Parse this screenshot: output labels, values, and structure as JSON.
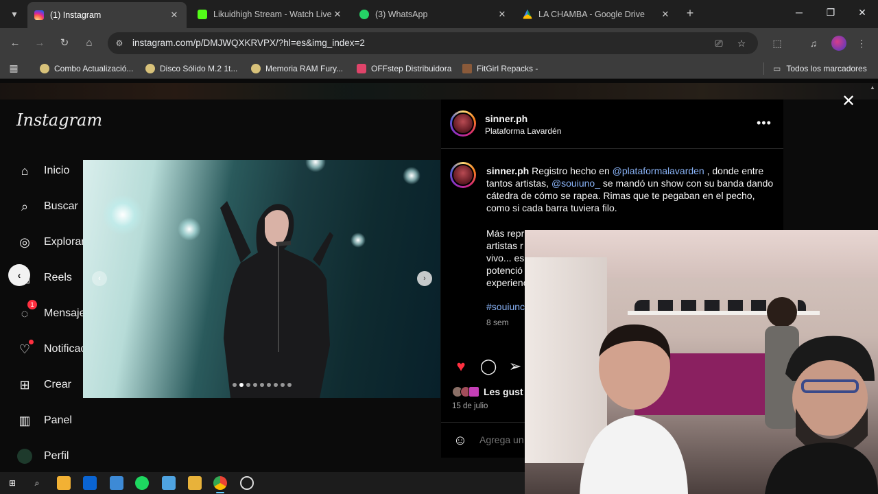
{
  "browser": {
    "tabs": [
      {
        "title": "(1) Instagram",
        "active": true,
        "favicon_color": "#d6249f"
      },
      {
        "title": "Likuidhigh Stream - Watch Live",
        "active": false,
        "favicon_color": "#53fc18"
      },
      {
        "title": "(3) WhatsApp",
        "active": false,
        "favicon_color": "#25d366"
      },
      {
        "title": "LA CHAMBA - Google Drive",
        "active": false,
        "favicon_color": "#fbbc04"
      }
    ],
    "url": "instagram.com/p/DMJWQXKRVPX/?hl=es&img_index=2",
    "bookmarks": [
      {
        "label": "Combo Actualizació...",
        "icon_color": "#d8c27a"
      },
      {
        "label": "Disco Sólido M.2 1t...",
        "icon_color": "#d8c27a"
      },
      {
        "label": "Memoria RAM Fury...",
        "icon_color": "#d8c27a"
      },
      {
        "label": "OFFstep Distribuidora",
        "icon_color": "#e0446a"
      },
      {
        "label": "FitGirl Repacks -",
        "icon_color": "#8a5a3a"
      }
    ],
    "all_bookmarks": "Todos los marcadores"
  },
  "instagram": {
    "logo": "Instagram",
    "nav": [
      {
        "label": "Inicio",
        "icon": "home-icon"
      },
      {
        "label": "Buscar",
        "icon": "search-icon"
      },
      {
        "label": "Explorar",
        "icon": "compass-icon"
      },
      {
        "label": "Reels",
        "icon": "reels-icon"
      },
      {
        "label": "Mensajes",
        "icon": "messenger-icon",
        "badge": "1"
      },
      {
        "label": "Notificaciones",
        "icon": "heart-icon"
      },
      {
        "label": "Crear",
        "icon": "plus-icon"
      },
      {
        "label": "Panel",
        "icon": "dashboard-icon"
      },
      {
        "label": "Perfil",
        "icon": "avatar"
      }
    ],
    "post": {
      "username": "sinner.ph",
      "location": "Plataforma Lavardén",
      "caption_user": "sinner.ph",
      "caption_text1": "Registro hecho en",
      "mention1": "@plataformalavarden",
      "caption_text2": ", donde entre tantos artistas,",
      "mention2": "@souiuno_",
      "caption_text3": "se mandó un show con su banda dando cátedra de cómo se rapea. Rimas que te pegaban en el pecho, como si cada barra tuviera filo.",
      "caption_visible_lines": [
        "Más repr",
        "artistas r",
        "vivo... es",
        "potenció",
        "experienc"
      ],
      "hashtag": "#souiunc",
      "age": "8 sem",
      "likes_text": "Les gust",
      "date": "15 de julio",
      "comment_placeholder": "Agrega un",
      "carousel_total": 9,
      "carousel_index": 2
    }
  },
  "taskbar": {
    "icons": [
      "windows-start-icon",
      "search-icon",
      "store-icon",
      "outlook-icon",
      "calculator-icon",
      "spotify-icon",
      "pen-icon",
      "file-explorer-icon",
      "chrome-icon",
      "obs-icon"
    ]
  }
}
